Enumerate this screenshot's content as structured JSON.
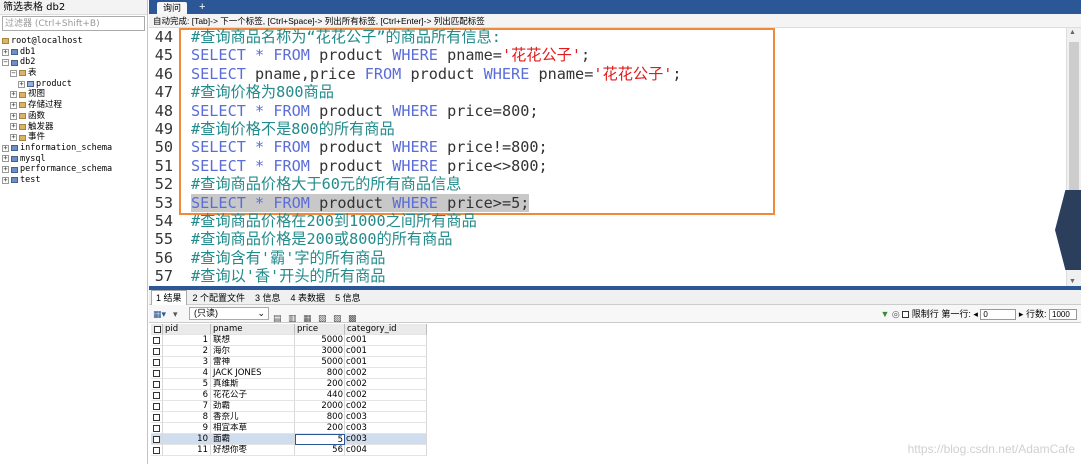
{
  "sidebar": {
    "title": "筛选表格 db2",
    "filter_placeholder": "过滤器 (Ctrl+Shift+B)",
    "tree": [
      {
        "label": "root@localhost",
        "indent": 0,
        "pm": "",
        "icon": "server"
      },
      {
        "label": "db1",
        "indent": 0,
        "pm": "+",
        "icon": "db"
      },
      {
        "label": "db2",
        "indent": 0,
        "pm": "-",
        "icon": "db"
      },
      {
        "label": "表",
        "indent": 1,
        "pm": "-",
        "icon": "folder"
      },
      {
        "label": "product",
        "indent": 2,
        "pm": "+",
        "icon": "tb"
      },
      {
        "label": "视图",
        "indent": 1,
        "pm": "+",
        "icon": "folder"
      },
      {
        "label": "存储过程",
        "indent": 1,
        "pm": "+",
        "icon": "folder"
      },
      {
        "label": "函数",
        "indent": 1,
        "pm": "+",
        "icon": "folder"
      },
      {
        "label": "触发器",
        "indent": 1,
        "pm": "+",
        "icon": "folder"
      },
      {
        "label": "事件",
        "indent": 1,
        "pm": "+",
        "icon": "folder"
      },
      {
        "label": "information_schema",
        "indent": 0,
        "pm": "+",
        "icon": "db"
      },
      {
        "label": "mysql",
        "indent": 0,
        "pm": "+",
        "icon": "db"
      },
      {
        "label": "performance_schema",
        "indent": 0,
        "pm": "+",
        "icon": "db"
      },
      {
        "label": "test",
        "indent": 0,
        "pm": "+",
        "icon": "db"
      }
    ]
  },
  "editor": {
    "tab_label": "询问",
    "tab_add": "+",
    "hint": "自动完成: [Tab]-> 下一个标签, [Ctrl+Space]-> 列出所有标签, [Ctrl+Enter]-> 列出匹配标签",
    "lines": [
      {
        "n": "44",
        "parts": [
          [
            "cm",
            "#查询商品名称为“花花公子”的商品所有信息:"
          ]
        ]
      },
      {
        "n": "45",
        "parts": [
          [
            "kw",
            "SELECT"
          ],
          [
            "ident",
            " "
          ],
          [
            "kw",
            "*"
          ],
          [
            "ident",
            " "
          ],
          [
            "kw",
            "FROM"
          ],
          [
            "ident",
            " product "
          ],
          [
            "kw",
            "WHERE"
          ],
          [
            "ident",
            " pname="
          ],
          [
            "str",
            "'花花公子'"
          ],
          [
            "ident",
            ";"
          ]
        ]
      },
      {
        "n": "46",
        "parts": [
          [
            "kw",
            "SELECT"
          ],
          [
            "ident",
            " pname,price "
          ],
          [
            "kw",
            "FROM"
          ],
          [
            "ident",
            " product "
          ],
          [
            "kw",
            "WHERE"
          ],
          [
            "ident",
            " pname="
          ],
          [
            "str",
            "'花花公子'"
          ],
          [
            "ident",
            ";"
          ]
        ]
      },
      {
        "n": "47",
        "parts": [
          [
            "cm",
            "#查询价格为800商品"
          ]
        ]
      },
      {
        "n": "48",
        "parts": [
          [
            "kw",
            "SELECT"
          ],
          [
            "ident",
            " "
          ],
          [
            "kw",
            "*"
          ],
          [
            "ident",
            " "
          ],
          [
            "kw",
            "FROM"
          ],
          [
            "ident",
            " product "
          ],
          [
            "kw",
            "WHERE"
          ],
          [
            "ident",
            " price=800;"
          ]
        ]
      },
      {
        "n": "49",
        "parts": [
          [
            "cm",
            "#查询价格不是800的所有商品"
          ]
        ]
      },
      {
        "n": "50",
        "parts": [
          [
            "kw",
            "SELECT"
          ],
          [
            "ident",
            " "
          ],
          [
            "kw",
            "*"
          ],
          [
            "ident",
            " "
          ],
          [
            "kw",
            "FROM"
          ],
          [
            "ident",
            " product "
          ],
          [
            "kw",
            "WHERE"
          ],
          [
            "ident",
            " price!=800;"
          ]
        ]
      },
      {
        "n": "51",
        "parts": [
          [
            "kw",
            "SELECT"
          ],
          [
            "ident",
            " "
          ],
          [
            "kw",
            "*"
          ],
          [
            "ident",
            " "
          ],
          [
            "kw",
            "FROM"
          ],
          [
            "ident",
            " product "
          ],
          [
            "kw",
            "WHERE"
          ],
          [
            "ident",
            " price<>800;"
          ]
        ]
      },
      {
        "n": "52",
        "parts": [
          [
            "cm",
            "#查询商品价格大于60元的所有商品信息"
          ]
        ]
      },
      {
        "n": "53",
        "sel": true,
        "parts": [
          [
            "kw",
            "SELECT"
          ],
          [
            "ident",
            " "
          ],
          [
            "kw",
            "*"
          ],
          [
            "ident",
            " "
          ],
          [
            "kw",
            "FROM"
          ],
          [
            "ident",
            " product "
          ],
          [
            "kw",
            "WHERE"
          ],
          [
            "ident",
            " price>=5;"
          ]
        ]
      },
      {
        "n": "54",
        "parts": [
          [
            "cm",
            "#查询商品价格在200到1000之间所有商品"
          ]
        ]
      },
      {
        "n": "55",
        "parts": [
          [
            "cm",
            "#查询商品价格是200或800的所有商品"
          ]
        ]
      },
      {
        "n": "56",
        "parts": [
          [
            "cm",
            "#查询含有'霸'字的所有商品"
          ]
        ]
      },
      {
        "n": "57",
        "parts": [
          [
            "cm",
            "#查询以'香'开头的所有商品"
          ]
        ]
      }
    ]
  },
  "results": {
    "tabs": [
      {
        "label": "1 结果",
        "active": true
      },
      {
        "label": "2 个配置文件",
        "active": false
      },
      {
        "label": "3 信息",
        "active": false
      },
      {
        "label": "4 表数据",
        "active": false
      },
      {
        "label": "5 信息",
        "active": false
      }
    ],
    "readonly_label": "(只读)",
    "limit_label": "限制行",
    "first_row_label": "第一行:",
    "first_row_value": "0",
    "rows_label": "行数:",
    "rows_value": "1000",
    "columns": [
      "pid",
      "pname",
      "price",
      "category_id"
    ],
    "rows": [
      [
        "1",
        "联想",
        "5000",
        "c001"
      ],
      [
        "2",
        "海尔",
        "3000",
        "c001"
      ],
      [
        "3",
        "雷神",
        "5000",
        "c001"
      ],
      [
        "4",
        "JACK JONES",
        "800",
        "c002"
      ],
      [
        "5",
        "真维斯",
        "200",
        "c002"
      ],
      [
        "6",
        "花花公子",
        "440",
        "c002"
      ],
      [
        "7",
        "劲霸",
        "2000",
        "c002"
      ],
      [
        "8",
        "香奈儿",
        "800",
        "c003"
      ],
      [
        "9",
        "相宜本草",
        "200",
        "c003"
      ],
      [
        "10",
        "面霸",
        "5",
        "c003"
      ],
      [
        "11",
        "好想你枣",
        "56",
        "c004"
      ]
    ],
    "highlight_row": 9
  },
  "watermark": "https://blog.csdn.net/AdamCafe",
  "colors": {
    "accent": "#2b5797",
    "highlight_box": "#f08a3a",
    "keyword": "#5b6dd8",
    "comment": "#228b8b",
    "string": "#e01b1b"
  }
}
